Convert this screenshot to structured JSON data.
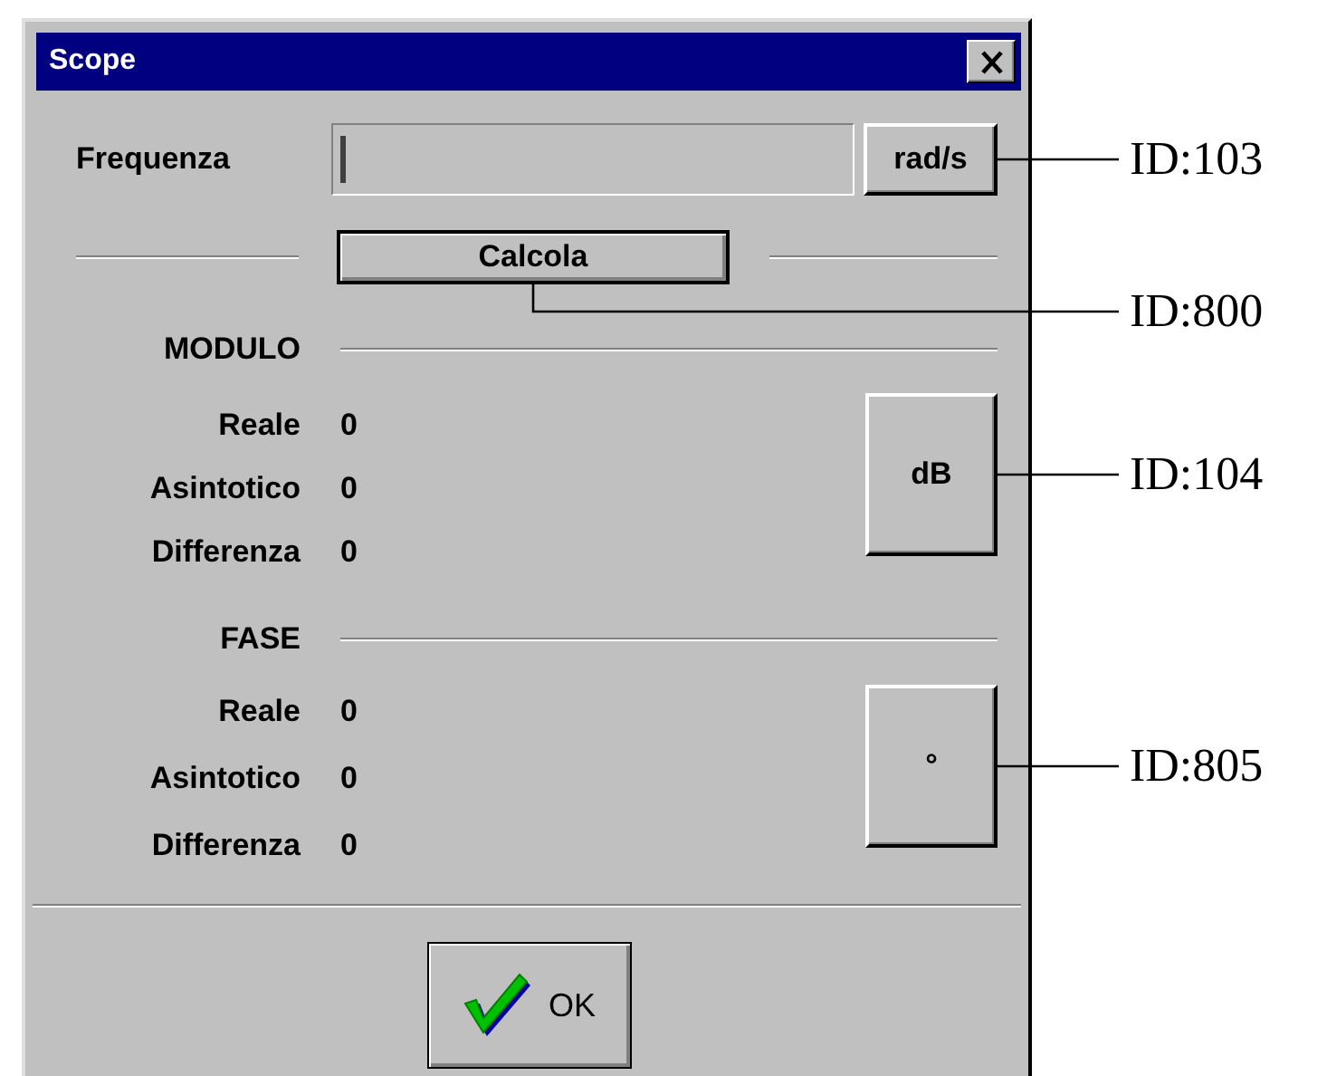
{
  "window": {
    "title": "Scope"
  },
  "frequency": {
    "label": "Frequenza",
    "unit_button": "rad/s"
  },
  "calculate_button": "Calcola",
  "sections": [
    {
      "title": "MODULO",
      "unit_button": "dB",
      "rows": [
        {
          "label": "Reale",
          "value": "0"
        },
        {
          "label": "Asintotico",
          "value": "0"
        },
        {
          "label": "Differenza",
          "value": "0"
        }
      ]
    },
    {
      "title": "FASE",
      "unit_button": "°",
      "rows": [
        {
          "label": "Reale",
          "value": "0"
        },
        {
          "label": "Asintotico",
          "value": "0"
        },
        {
          "label": "Differenza",
          "value": "0"
        }
      ]
    }
  ],
  "ok_button": "OK",
  "annotations": [
    {
      "label": "ID:103"
    },
    {
      "label": "ID:800"
    },
    {
      "label": "ID:104"
    },
    {
      "label": "ID:805"
    }
  ]
}
